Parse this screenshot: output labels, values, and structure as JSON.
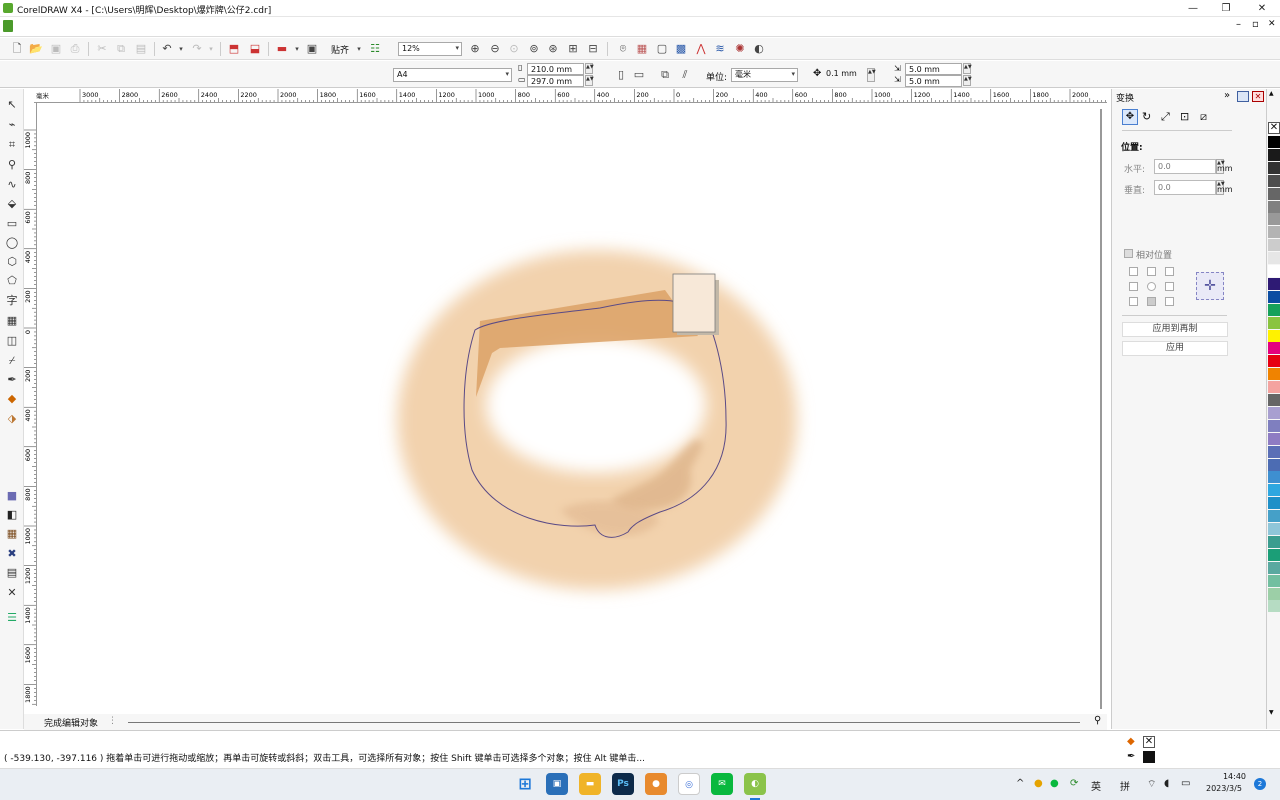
{
  "window": {
    "title": "CorelDRAW X4 - [C:\\Users\\明辉\\Desktop\\爆炸牌\\公仔2.cdr]",
    "min": "—",
    "max": "❐",
    "close": "✕",
    "doc_min": "–",
    "doc_max": "▫",
    "doc_close": "✕"
  },
  "toolbar": {
    "zoom": "12%",
    "snap": "贴齐"
  },
  "propbar": {
    "page_size": "A4",
    "width": "210.0 mm",
    "height": "297.0 mm",
    "units_label": "单位:",
    "units": "毫米",
    "nudge": "0.1 mm",
    "dup_x": "5.0 mm",
    "dup_y": "5.0 mm"
  },
  "ruler_top": [
    "3000",
    "2800",
    "2600",
    "2400",
    "2200",
    "2000",
    "1800",
    "1600",
    "1400",
    "1200",
    "1000",
    "800",
    "600",
    "400",
    "200",
    "0",
    "200",
    "400",
    "600",
    "800",
    "1000",
    "1200",
    "1400",
    "1600",
    "1800",
    "2000",
    "2200"
  ],
  "ruler_top_unit": "毫米",
  "ruler_left": [
    "1000",
    "800",
    "600",
    "400",
    "200",
    "0",
    "200",
    "400",
    "600",
    "800",
    "1000",
    "1200",
    "1400",
    "1600",
    "1800"
  ],
  "page_tab": "完成编辑对象",
  "docker": {
    "title": "变换",
    "position": "位置:",
    "h_label": "水平:",
    "h_value": "0.0",
    "v_label": "垂直:",
    "v_value": "0.0",
    "unit": "mm",
    "relative": "相对位置",
    "apply_dup": "应用到再制",
    "apply": "应用"
  },
  "palette": [
    "#000000",
    "#1a1a1a",
    "#333333",
    "#4d4d4d",
    "#666666",
    "#808080",
    "#999999",
    "#b3b3b3",
    "#cccccc",
    "#e6e6e6",
    "#ffffff",
    "#2e1a74",
    "#0b4da2",
    "#16a15b",
    "#8ac43f",
    "#fff200",
    "#e4007f",
    "#e60012",
    "#f08300",
    "#f4a3a0",
    "#666666",
    "#a89fd0",
    "#7f7fbf",
    "#8e7cc3",
    "#5b6fb6",
    "#4c6cb3",
    "#3e8fd0",
    "#2ea7e0",
    "#1e90c8",
    "#45a0c8",
    "#8fc6d9",
    "#3b9d8f",
    "#1b9e77",
    "#5aa9a0",
    "#72bfa0",
    "#9ccfa7",
    "#b6dcc3"
  ],
  "status": {
    "coords": "( -539.130, -397.116 )",
    "hint": "拖着单击可进行拖动或缩放；再单击可旋转或斜斜；双击工具，可选择所有对象；按住 Shift 键单击可选择多个对象；按住 Alt 键单击..."
  },
  "taskbar": {
    "ime1": "英",
    "ime2": "拼",
    "time": "14:40",
    "date": "2023/3/5",
    "badge": "2"
  }
}
